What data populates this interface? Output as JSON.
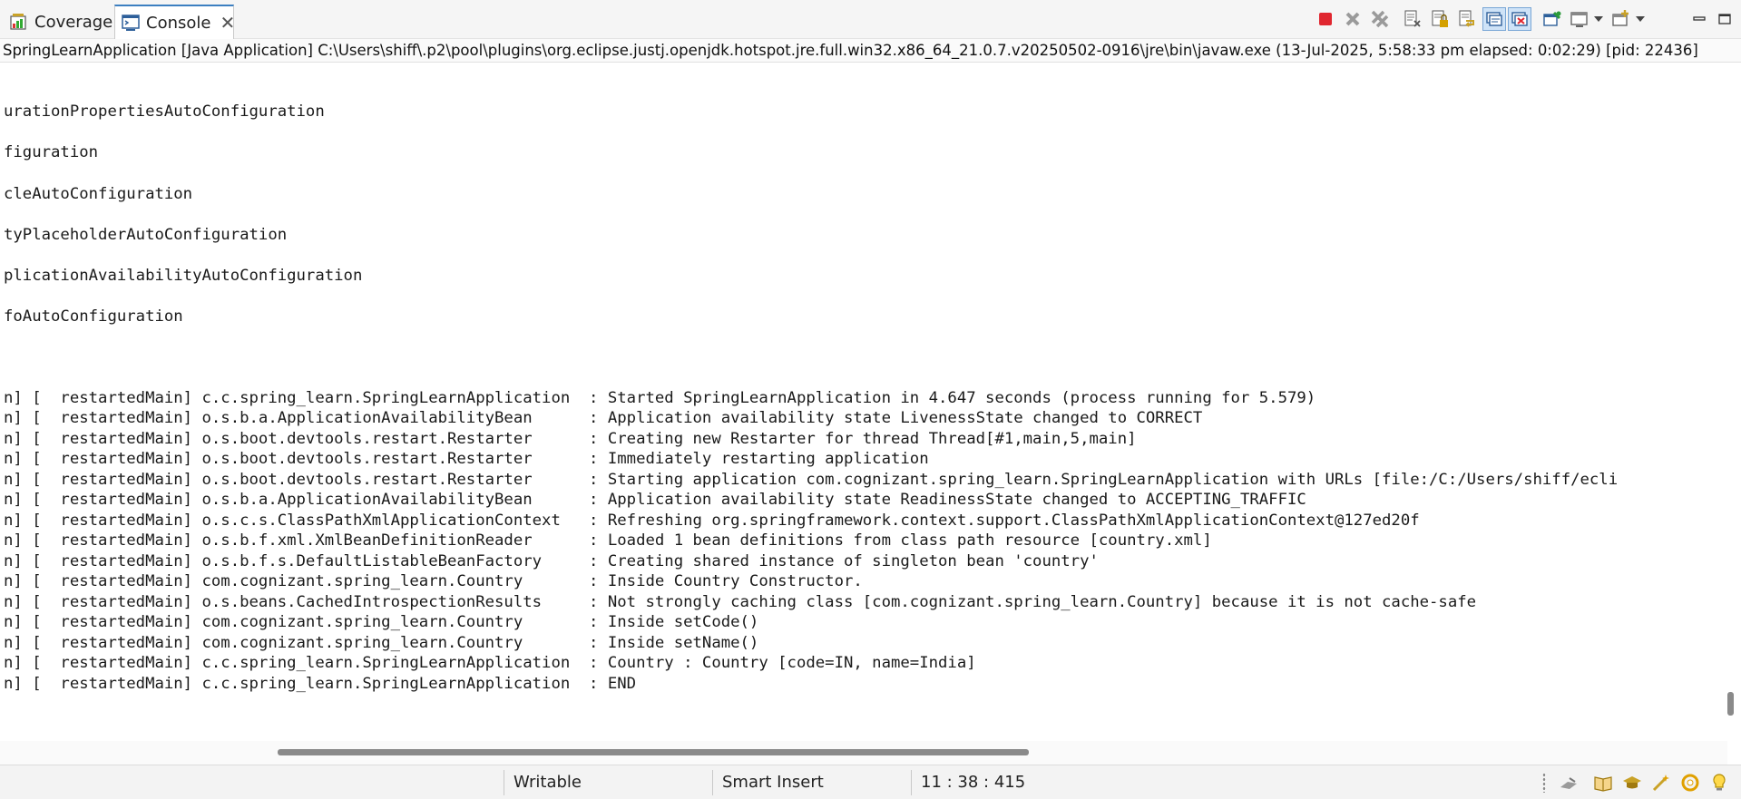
{
  "tabs": [
    {
      "label": "Coverage",
      "icon": "coverage-icon",
      "active": false
    },
    {
      "label": "Console",
      "icon": "console-icon",
      "active": true,
      "closable": true
    }
  ],
  "toolbar": [
    {
      "name": "terminate-icon",
      "pressed": false
    },
    {
      "name": "remove-launch-icon",
      "pressed": false
    },
    {
      "name": "remove-all-terminated-icon",
      "pressed": false
    },
    {
      "name": "clear-console-icon",
      "pressed": false
    },
    {
      "name": "scroll-lock-icon",
      "pressed": false
    },
    {
      "name": "word-wrap-icon",
      "pressed": false
    },
    {
      "name": "show-console-on-stdout-icon",
      "pressed": true
    },
    {
      "name": "show-console-on-stderr-icon",
      "pressed": true
    },
    {
      "name": "pin-console-icon",
      "pressed": false
    },
    {
      "name": "display-selected-console-icon",
      "pressed": false
    },
    {
      "name": "open-console-icon",
      "pressed": false
    },
    {
      "name": "minimize-icon",
      "pressed": false
    },
    {
      "name": "maximize-icon",
      "pressed": false
    }
  ],
  "process_description": "SpringLearnApplication [Java Application] C:\\Users\\shiff\\.p2\\pool\\plugins\\org.eclipse.justj.openjdk.hotspot.jre.full.win32.x86_64_21.0.7.v20250502-0916\\jre\\bin\\javaw.exe  (13-Jul-2025, 5:58:33 pm elapsed: 0:02:29) [pid: 22436]",
  "console_lines": [
    "urationPropertiesAutoConfiguration",
    "figuration",
    "cleAutoConfiguration",
    "tyPlaceholderAutoConfiguration",
    "plicationAvailabilityAutoConfiguration",
    "foAutoConfiguration",
    "n] [  restartedMain] c.c.spring_learn.SpringLearnApplication  : Started SpringLearnApplication in 4.647 seconds (process running for 5.579)",
    "n] [  restartedMain] o.s.b.a.ApplicationAvailabilityBean      : Application availability state LivenessState changed to CORRECT",
    "n] [  restartedMain] o.s.boot.devtools.restart.Restarter      : Creating new Restarter for thread Thread[#1,main,5,main]",
    "n] [  restartedMain] o.s.boot.devtools.restart.Restarter      : Immediately restarting application",
    "n] [  restartedMain] o.s.boot.devtools.restart.Restarter      : Starting application com.cognizant.spring_learn.SpringLearnApplication with URLs [file:/C:/Users/shiff/ecli",
    "n] [  restartedMain] o.s.b.a.ApplicationAvailabilityBean      : Application availability state ReadinessState changed to ACCEPTING_TRAFFIC",
    "n] [  restartedMain] o.s.c.s.ClassPathXmlApplicationContext   : Refreshing org.springframework.context.support.ClassPathXmlApplicationContext@127ed20f",
    "n] [  restartedMain] o.s.b.f.xml.XmlBeanDefinitionReader      : Loaded 1 bean definitions from class path resource [country.xml]",
    "n] [  restartedMain] o.s.b.f.s.DefaultListableBeanFactory     : Creating shared instance of singleton bean 'country'",
    "n] [  restartedMain] com.cognizant.spring_learn.Country       : Inside Country Constructor.",
    "n] [  restartedMain] o.s.beans.CachedIntrospectionResults     : Not strongly caching class [com.cognizant.spring_learn.Country] because it is not cache-safe",
    "n] [  restartedMain] com.cognizant.spring_learn.Country       : Inside setCode()",
    "n] [  restartedMain] com.cognizant.spring_learn.Country       : Inside setName()",
    "n] [  restartedMain] c.c.spring_learn.SpringLearnApplication  : Country : Country [code=IN, name=India]",
    "n] [  restartedMain] c.c.spring_learn.SpringLearnApplication  : END"
  ],
  "status": {
    "mode": "Writable",
    "insert_mode": "Smart Insert",
    "position": "11 : 38 : 415"
  },
  "status_icons": [
    "progress-icon",
    "book-icon",
    "graduation-cap-icon",
    "magic-wand-icon",
    "help-lifebuoy-icon",
    "lightbulb-icon"
  ],
  "colors": {
    "terminate": "#e0262f",
    "active_tab_accent": "#3c7fc1",
    "pressed_button": "#cfe3f7"
  }
}
